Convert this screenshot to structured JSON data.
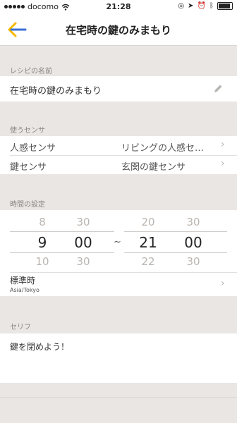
{
  "status_bar": {
    "carrier": "docomo",
    "time": "21:28"
  },
  "nav": {
    "title": "在宅時の鍵のみまもり",
    "back_icon": "back-arrow-icon",
    "accent_color": "#f5b800"
  },
  "recipe_name": {
    "header": "レシピの名前",
    "value": "在宅時の鍵のみまもり",
    "edit_icon": "pencil-icon"
  },
  "sensors": {
    "header": "使うセンサ",
    "rows": [
      {
        "type": "人感センサ",
        "value": "リビングの人感セ…"
      },
      {
        "type": "鍵センサ",
        "value": "玄関の鍵センサ"
      }
    ]
  },
  "time_setting": {
    "header": "時間の設定",
    "start": {
      "hour_prev": "8",
      "hour": "9",
      "hour_next": "10",
      "min_prev": "30",
      "min": "00",
      "min_next": "30"
    },
    "separator": "~",
    "end": {
      "hour_prev": "20",
      "hour": "21",
      "hour_next": "22",
      "min_prev": "30",
      "min": "00",
      "min_next": "30"
    },
    "timezone_label": "標準時",
    "timezone_value": "Asia/Tokyo"
  },
  "serif": {
    "header": "セリフ",
    "value": "鍵を閉めよう！"
  }
}
